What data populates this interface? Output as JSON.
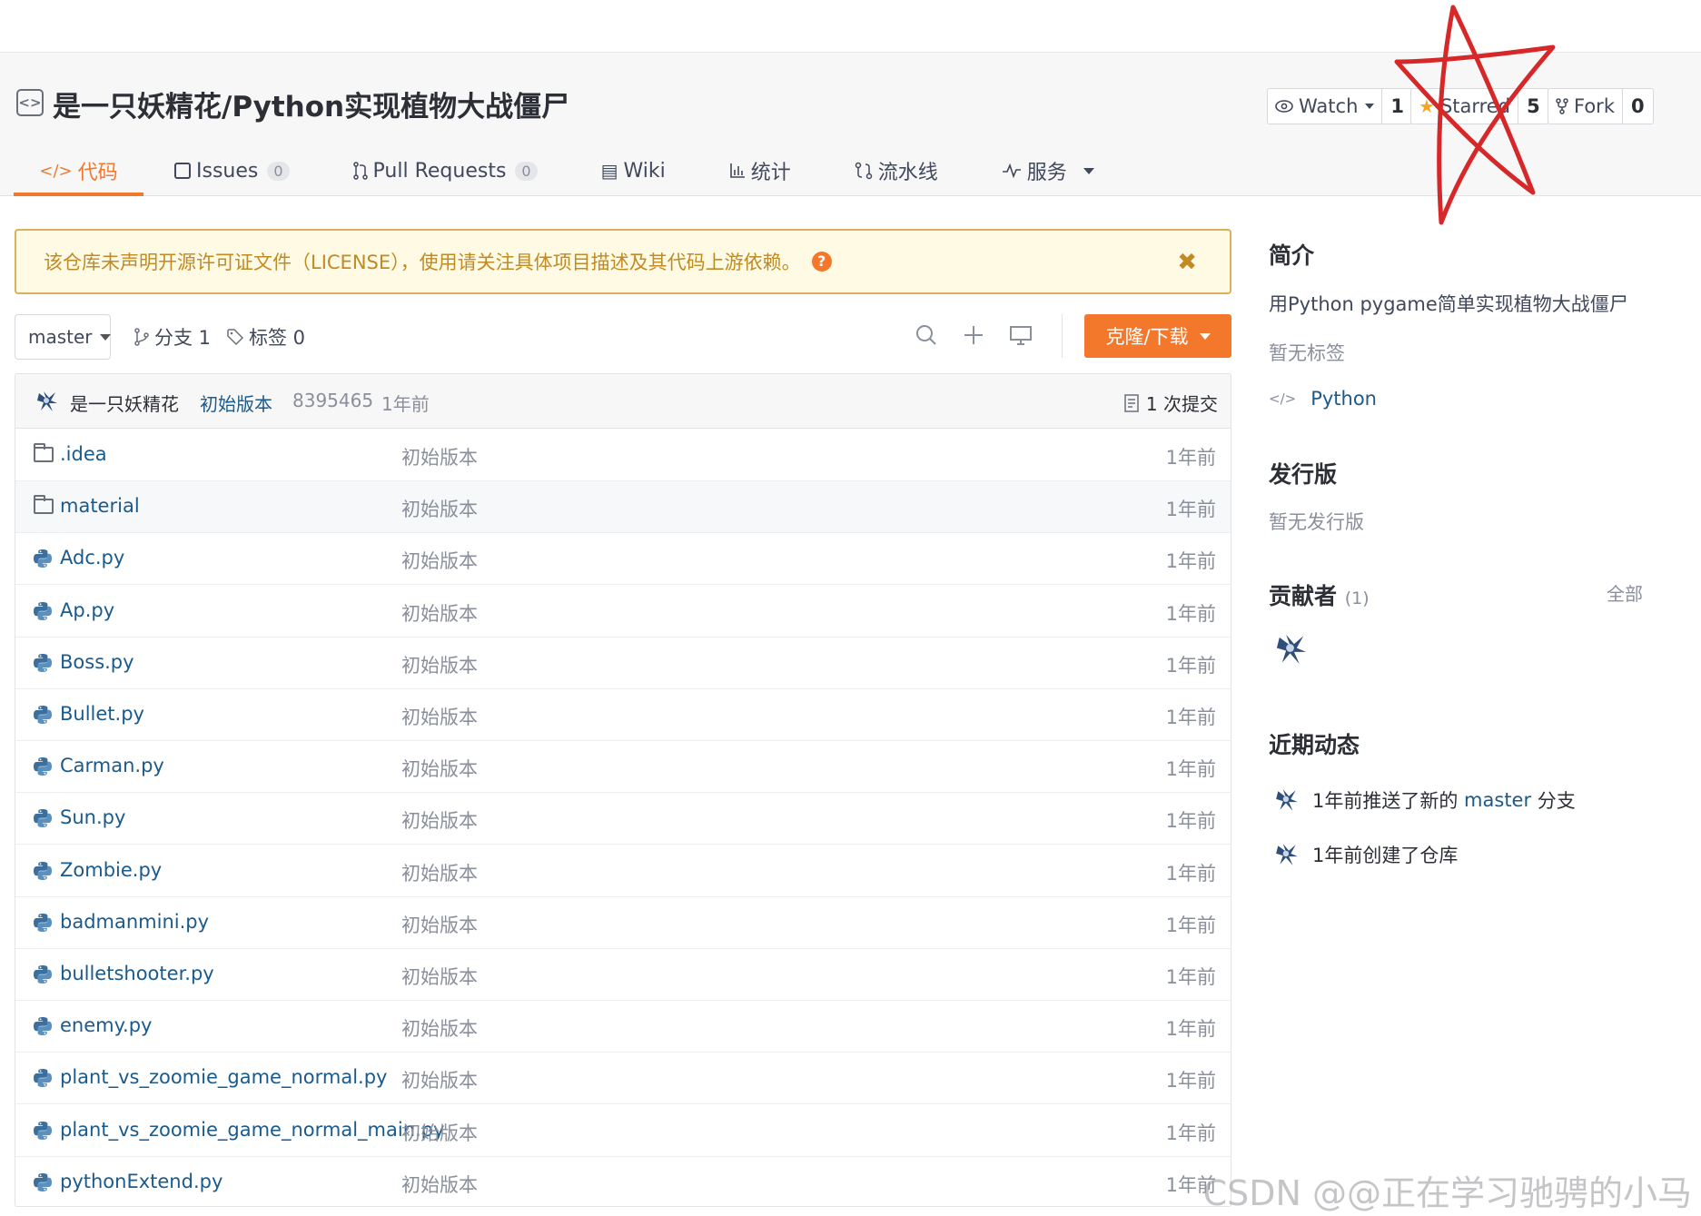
{
  "repo": {
    "title": "是一只妖精花/Python实现植物大战僵尸"
  },
  "actions": {
    "watch_label": "Watch",
    "watch_count": "1",
    "star_label": "Starred",
    "star_count": "5",
    "fork_label": "Fork",
    "fork_count": "0"
  },
  "tabs": [
    {
      "label": "代码",
      "icon": "code-icon"
    },
    {
      "label": "Issues",
      "badge": "0",
      "icon": "issues-icon"
    },
    {
      "label": "Pull Requests",
      "badge": "0",
      "icon": "pull-request-icon"
    },
    {
      "label": "Wiki",
      "icon": "wiki-icon"
    },
    {
      "label": "统计",
      "icon": "stats-icon"
    },
    {
      "label": "流水线",
      "icon": "pipeline-icon"
    },
    {
      "label": "服务",
      "icon": "service-icon"
    }
  ],
  "notice": {
    "text": "该仓库未声明开源许可证文件（LICENSE），使用请关注具体项目描述及其代码上游依赖。",
    "close": "✖"
  },
  "toolbar": {
    "branch": "master",
    "branches_label": "分支 1",
    "tags_label": "标签 0",
    "clone_label": "克隆/下载"
  },
  "commit": {
    "author": "是一只妖精花",
    "message": "初始版本",
    "hash": "8395465",
    "time": "1年前",
    "count_label": "1 次提交"
  },
  "files": [
    {
      "name": ".idea",
      "type": "folder",
      "message": "初始版本",
      "time": "1年前"
    },
    {
      "name": "material",
      "type": "folder",
      "message": "初始版本",
      "time": "1年前"
    },
    {
      "name": "Adc.py",
      "type": "python",
      "message": "初始版本",
      "time": "1年前"
    },
    {
      "name": "Ap.py",
      "type": "python",
      "message": "初始版本",
      "time": "1年前"
    },
    {
      "name": "Boss.py",
      "type": "python",
      "message": "初始版本",
      "time": "1年前"
    },
    {
      "name": "Bullet.py",
      "type": "python",
      "message": "初始版本",
      "time": "1年前"
    },
    {
      "name": "Carman.py",
      "type": "python",
      "message": "初始版本",
      "time": "1年前"
    },
    {
      "name": "Sun.py",
      "type": "python",
      "message": "初始版本",
      "time": "1年前"
    },
    {
      "name": "Zombie.py",
      "type": "python",
      "message": "初始版本",
      "time": "1年前"
    },
    {
      "name": "badmanmini.py",
      "type": "python",
      "message": "初始版本",
      "time": "1年前"
    },
    {
      "name": "bulletshooter.py",
      "type": "python",
      "message": "初始版本",
      "time": "1年前"
    },
    {
      "name": "enemy.py",
      "type": "python",
      "message": "初始版本",
      "time": "1年前"
    },
    {
      "name": "plant_vs_zoomie_game_normal.py",
      "type": "python",
      "message": "初始版本",
      "time": "1年前"
    },
    {
      "name": "plant_vs_zoomie_game_normal_main.py",
      "type": "python",
      "message": "初始版本",
      "time": "1年前"
    },
    {
      "name": "pythonExtend.py",
      "type": "python",
      "message": "初始版本",
      "time": "1年前"
    }
  ],
  "sidebar": {
    "intro_title": "简介",
    "intro_text": "用Python pygame简单实现植物大战僵尸",
    "no_tags": "暂无标签",
    "language": "Python",
    "release_title": "发行版",
    "no_release": "暂无发行版",
    "contributors_title": "贡献者",
    "contributors_count": "(1)",
    "contributors_all": "全部",
    "activity_title": "近期动态",
    "activities": [
      {
        "prefix": "1年前推送了新的 ",
        "link": "master",
        "suffix": " 分支"
      },
      {
        "prefix": "1年前创建了仓库",
        "link": "",
        "suffix": ""
      }
    ]
  },
  "colors": {
    "accent": "#f4782b",
    "link": "#1b5a8c",
    "notice_bg": "#fffae3",
    "notice_border": "#dcb15b",
    "scribble": "#d62828"
  },
  "watermark": "CSDN @@正在学习驰骋的小马"
}
